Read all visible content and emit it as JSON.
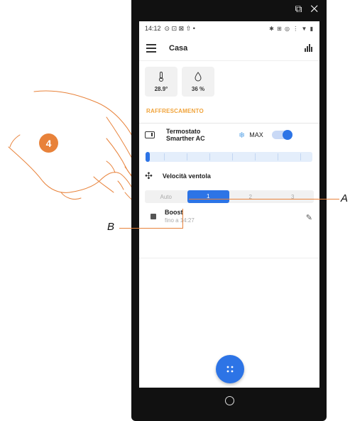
{
  "window": {
    "icons": "⧉ ✕"
  },
  "statusbar": {
    "time": "14:12",
    "left_icons": "⊙ ⊡ ⊠ ⇧ •",
    "right_icons": "✱ ⊞ ◎ ⋮ ▼ ▮"
  },
  "header": {
    "title": "Casa",
    "menu_icon": "menu-icon",
    "stats_icon": "bar-chart-icon"
  },
  "sensors": [
    {
      "icon": "thermometer-icon",
      "glyph": "🌡",
      "value": "28.9°"
    },
    {
      "icon": "humidity-drop-icon",
      "glyph": "💧",
      "value": "36 %"
    }
  ],
  "section": {
    "title": "RAFFRESCAMENTO"
  },
  "thermostat": {
    "name": "Termostato Smarther AC",
    "mode_icon": "snowflake-icon",
    "mode_label": "MAX",
    "enabled": true,
    "level": 0.0
  },
  "fan": {
    "label": "Velocità ventola",
    "options": [
      "Auto",
      "1",
      "2",
      "3"
    ],
    "selected": "1"
  },
  "boost": {
    "title": "Boost",
    "subtitle": "fino a 14:27"
  },
  "fab": {
    "icon": "grid-dots-icon"
  },
  "annotations": {
    "step": "4",
    "label_a": "A",
    "label_b": "B"
  },
  "colors": {
    "accent": "#2d74e6",
    "section": "#f0a33a",
    "annotation": "#e8823a"
  }
}
